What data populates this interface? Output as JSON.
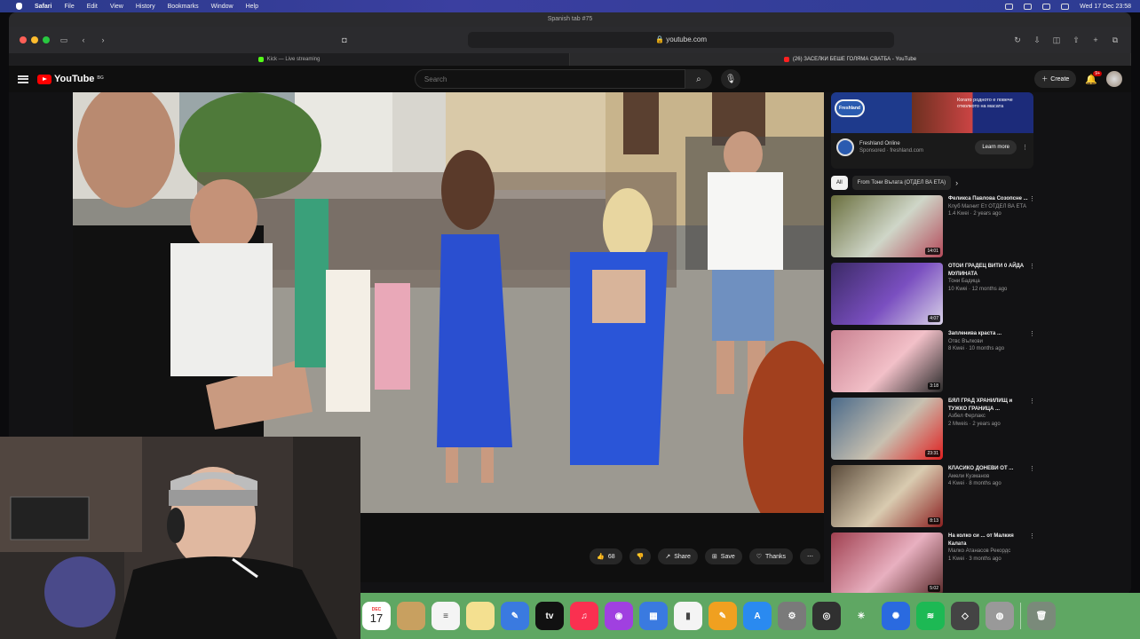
{
  "menubar": {
    "items": [
      "Safari",
      "File",
      "Edit",
      "View",
      "History",
      "Bookmarks",
      "Window",
      "Help"
    ],
    "datetime": "Wed 17 Dec 23:58"
  },
  "browser": {
    "window_title": "Spanish tab #75",
    "url": "youtube.com",
    "tabs": [
      {
        "title": "Kick — Live streaming",
        "active": false,
        "favicon_color": "#53fc18"
      },
      {
        "title": "(26) ЗАСЕЛКИ БЕШЕ ГОЛЯМА СВАТБА - YouTube",
        "active": true,
        "favicon_color": "#ff2020"
      }
    ]
  },
  "youtube": {
    "logo": "YouTube",
    "logo_region": "BG",
    "search_placeholder": "Search",
    "create_label": "Create",
    "notification_count": "9+",
    "video_actions": [
      {
        "icon": "like-icon",
        "label": "68"
      },
      {
        "icon": "dislike-icon",
        "label": ""
      },
      {
        "icon": "share-icon",
        "label": "Share"
      },
      {
        "icon": "save-icon",
        "label": "Save"
      },
      {
        "icon": "thanks-icon",
        "label": "Thanks"
      }
    ],
    "more_actions": "⋯"
  },
  "sidebar": {
    "ad": {
      "banner_badge": "Freshland",
      "banner_text": "Когато родното е повече отколкото на масата",
      "advertiser": "Freshland Online",
      "sponsored": "Sponsored · freshland.com",
      "cta": "Learn more"
    },
    "chips": [
      "All",
      "From Тони Вълата (ОТДЕЛ ВА ЕТА)"
    ],
    "recommendations": [
      {
        "title": "Феликса Павлова Созопсне ...",
        "channel": "Клуб Магнит Ет ОТДЕЛ ВА ЕТА",
        "stats": "1.4 Kwei · 2 years ago",
        "duration": "14:01",
        "thumb": [
          "#6a6f3e",
          "#cfd6c8",
          "#b44a5a"
        ]
      },
      {
        "title": "ОТОИ ГРАДЕЦ ВИТИ 0 АЙДА МУЛИНАТА",
        "channel": "Тони Бадица",
        "stats": "10 Kwei · 12 months ago",
        "duration": "4:07",
        "thumb": [
          "#3b2a66",
          "#7a4fc0",
          "#d9d2e8"
        ]
      },
      {
        "title": "Запленива краста ...",
        "channel": "Отвс Вълкови",
        "stats": "8 Kwei · 10 months ago",
        "duration": "3:18",
        "thumb": [
          "#c98090",
          "#f2c0c8",
          "#2a2a2a"
        ]
      },
      {
        "title": "БЯЛ ГРАД ХРАНИЛИЩ и ТУЖКО ГРАНИЦА ...",
        "channel": "Азбел Ферлакс",
        "stats": "2 Mweis · 2 years ago",
        "duration": "23:31",
        "thumb": [
          "#4a6a8a",
          "#c8c0b0",
          "#e02020"
        ]
      },
      {
        "title": "КЛАСИКО ДОНЕВИ ОТ ...",
        "channel": "Амели Кузманов",
        "stats": "4 Kwei · 8 months ago",
        "duration": "8:13",
        "thumb": [
          "#5a4a3a",
          "#d9cbb0",
          "#8a2020"
        ]
      },
      {
        "title": "На колко си ... от Малкия Калата",
        "channel": "Малко Атанасов Рекордс",
        "stats": "1 Kwei · 3 months ago",
        "duration": "5:02",
        "thumb": [
          "#a04050",
          "#e8b0c0",
          "#5a2a2a"
        ]
      }
    ]
  },
  "dock": {
    "calendar_month": "DEC",
    "calendar_day": "17",
    "apps": [
      {
        "name": "notes-app",
        "color": "#c8a060",
        "glyph": ""
      },
      {
        "name": "reminders-app",
        "color": "#f4f4f4",
        "glyph": "≡"
      },
      {
        "name": "stickies-app",
        "color": "#f4e090",
        "glyph": ""
      },
      {
        "name": "freeform-app",
        "color": "#3a7ae0",
        "glyph": "✎"
      },
      {
        "name": "tv-app",
        "color": "#111111",
        "glyph": "tv"
      },
      {
        "name": "music-app",
        "color": "#fa3050",
        "glyph": "♫"
      },
      {
        "name": "podcasts-app",
        "color": "#a040e0",
        "glyph": "◉"
      },
      {
        "name": "keynote-app",
        "color": "#3a7ae0",
        "glyph": "▦"
      },
      {
        "name": "numbers-app",
        "color": "#f4f4f4",
        "glyph": "▮"
      },
      {
        "name": "pages-app",
        "color": "#f0a020",
        "glyph": "✎"
      },
      {
        "name": "app-store-app",
        "color": "#2a8af0",
        "glyph": "A"
      },
      {
        "name": "system-settings-app",
        "color": "#7a7a7a",
        "glyph": "⚙"
      },
      {
        "name": "obs-app",
        "color": "#303030",
        "glyph": "◎"
      },
      {
        "name": "gemini-app",
        "color": "#5fa763",
        "glyph": "✳"
      },
      {
        "name": "audio-app",
        "color": "#2a6ae0",
        "glyph": "✺"
      },
      {
        "name": "spotify-app",
        "color": "#1db954",
        "glyph": "≋"
      },
      {
        "name": "utility-app",
        "color": "#444444",
        "glyph": "◇"
      },
      {
        "name": "disk-utility-app",
        "color": "#999999",
        "glyph": "◍"
      },
      {
        "name": "trash-app",
        "color": "#7a8a7a",
        "glyph": "🗑"
      }
    ]
  }
}
